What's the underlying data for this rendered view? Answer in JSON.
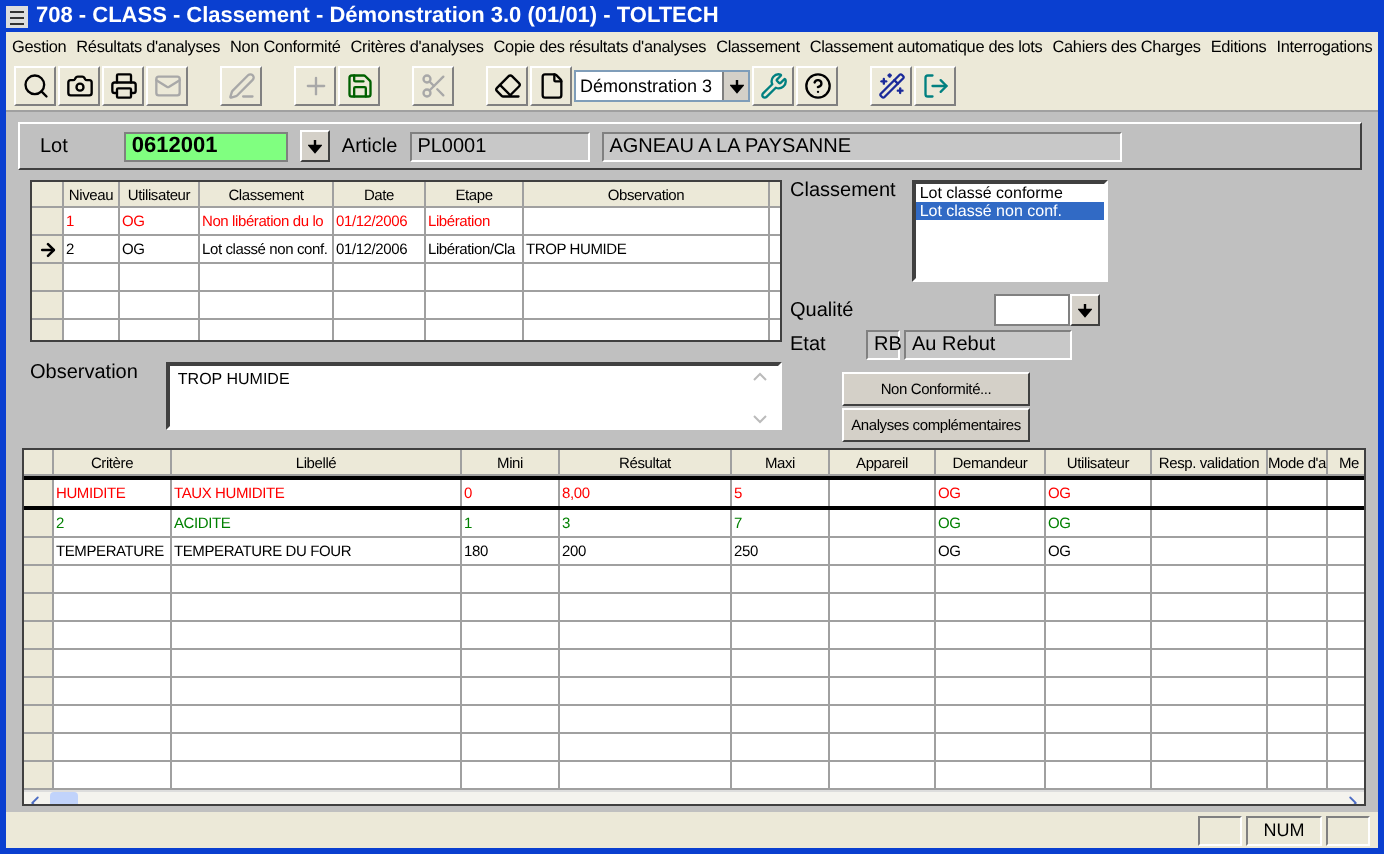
{
  "window": {
    "title": "708 - CLASS - Classement - Démonstration 3.0 (01/01) - TOLTECH"
  },
  "menu": [
    "Gestion",
    "Résultats d'analyses",
    "Non Conformité",
    "Critères d'analyses",
    "Copie des résultats d'analyses",
    "Classement",
    "Classement automatique des lots",
    "Cahiers des Charges",
    "Editions",
    "Interrogations"
  ],
  "toolbar": [
    {
      "kind": "button",
      "disabled": false
    },
    {
      "kind": "button",
      "disabled": false
    },
    {
      "kind": "button",
      "disabled": false
    },
    {
      "kind": "button",
      "disabled": true
    },
    {
      "kind": "gap"
    },
    {
      "kind": "button",
      "disabled": true
    },
    {
      "kind": "gap"
    },
    {
      "kind": "button",
      "disabled": true
    },
    {
      "kind": "button",
      "disabled": false
    },
    {
      "kind": "gap"
    },
    {
      "kind": "button",
      "disabled": true
    },
    {
      "kind": "gap"
    },
    {
      "kind": "button",
      "disabled": false
    },
    {
      "kind": "button",
      "disabled": false
    },
    {
      "kind": "select",
      "value": "Démonstration 3"
    },
    {
      "kind": "button",
      "disabled": false
    },
    {
      "kind": "button",
      "disabled": false
    },
    {
      "kind": "gap"
    },
    {
      "kind": "button",
      "disabled": false
    },
    {
      "kind": "button",
      "disabled": false
    }
  ],
  "lot": {
    "label": "Lot",
    "value": "0612001",
    "article_label": "Article",
    "article_code": "PL0001",
    "article_name": "AGNEAU A LA PAYSANNE"
  },
  "history": {
    "columns": [
      "Niveau",
      "Utilisateur",
      "Classement",
      "Date",
      "Etape",
      "Observation"
    ],
    "rows": [
      {
        "current": false,
        "color": "#ff0000",
        "cells": [
          "1",
          "OG",
          "Non libération du lo",
          "01/12/2006",
          "Libération",
          ""
        ]
      },
      {
        "current": true,
        "color": "#000000",
        "cells": [
          "2",
          "OG",
          "Lot classé non conf.",
          "01/12/2006",
          "Libération/Cla",
          "TROP HUMIDE"
        ]
      }
    ]
  },
  "classement": {
    "label": "Classement",
    "items": [
      {
        "label": "Lot classé conforme",
        "selected": false
      },
      {
        "label": "Lot classé non conf.",
        "selected": true
      }
    ]
  },
  "qualite": {
    "label": "Qualité"
  },
  "etat": {
    "label": "Etat",
    "code": "RB",
    "value": "Au Rebut"
  },
  "observation": {
    "label": "Observation",
    "value": "TROP HUMIDE"
  },
  "buttons": [
    "Non Conformité...",
    "Analyses complémentaires"
  ],
  "analyses": {
    "columns": [
      "Critère",
      "Libellé",
      "Mini",
      "Résultat",
      "Maxi",
      "Appareil",
      "Demandeur",
      "Utilisateur",
      "Resp. validation",
      "Mode d'a",
      "Me"
    ],
    "rows": [
      {
        "selected": true,
        "color": "#ff0000",
        "cells": [
          "HUMIDITE",
          "TAUX HUMIDITE",
          "0",
          "8,00",
          "5",
          "",
          "OG",
          "OG",
          "",
          "",
          ""
        ]
      },
      {
        "selected": false,
        "color": "#008000",
        "cells": [
          "2",
          "ACIDITE",
          "1",
          "3",
          "7",
          "",
          "OG",
          "OG",
          "",
          "",
          ""
        ]
      },
      {
        "selected": false,
        "color": "#000000",
        "cells": [
          "TEMPERATURE",
          "TEMPERATURE DU FOUR",
          "180",
          "200",
          "250",
          "",
          "OG",
          "OG",
          "",
          "",
          ""
        ]
      }
    ]
  },
  "status_bar": {
    "indicator": "NUM"
  }
}
